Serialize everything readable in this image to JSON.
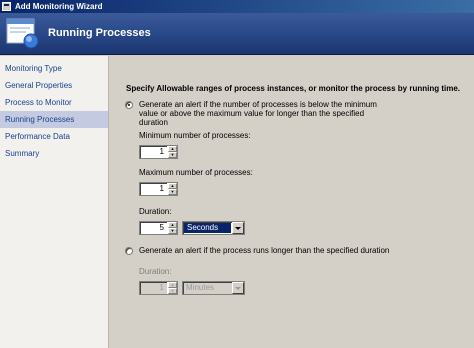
{
  "window": {
    "title": "Add Monitoring Wizard"
  },
  "header": {
    "title": "Running Processes"
  },
  "sidebar": {
    "items": [
      {
        "label": "Monitoring Type",
        "selected": false
      },
      {
        "label": "General Properties",
        "selected": false
      },
      {
        "label": "Process to Monitor",
        "selected": false
      },
      {
        "label": "Running Processes",
        "selected": true
      },
      {
        "label": "Performance Data",
        "selected": false
      },
      {
        "label": "Summary",
        "selected": false
      }
    ]
  },
  "main": {
    "heading": "Specify Allowable ranges of process instances, or monitor the process by running time.",
    "option1": {
      "label_line1": "Generate an alert if the number of processes is below the minimum",
      "label_line2": "value or above the maximum value for longer than the specified",
      "label_line3": "duration",
      "checked": true,
      "min_label": "Minimum number of processes:",
      "min_value": "1",
      "max_label": "Maximum number of processes:",
      "max_value": "1",
      "duration_label": "Duration:",
      "duration_value": "5",
      "duration_unit": "Seconds"
    },
    "option2": {
      "label": "Generate an alert if the process runs longer than the specified duration",
      "checked": false,
      "duration_label": "Duration:",
      "duration_value": "1",
      "duration_unit": "Minutes"
    }
  },
  "colors": {
    "header_bg": "#2a4a8a",
    "nav_link": "#1b3f91",
    "nav_selected_bg": "#c4cbe0",
    "selection": "#0a246a"
  }
}
